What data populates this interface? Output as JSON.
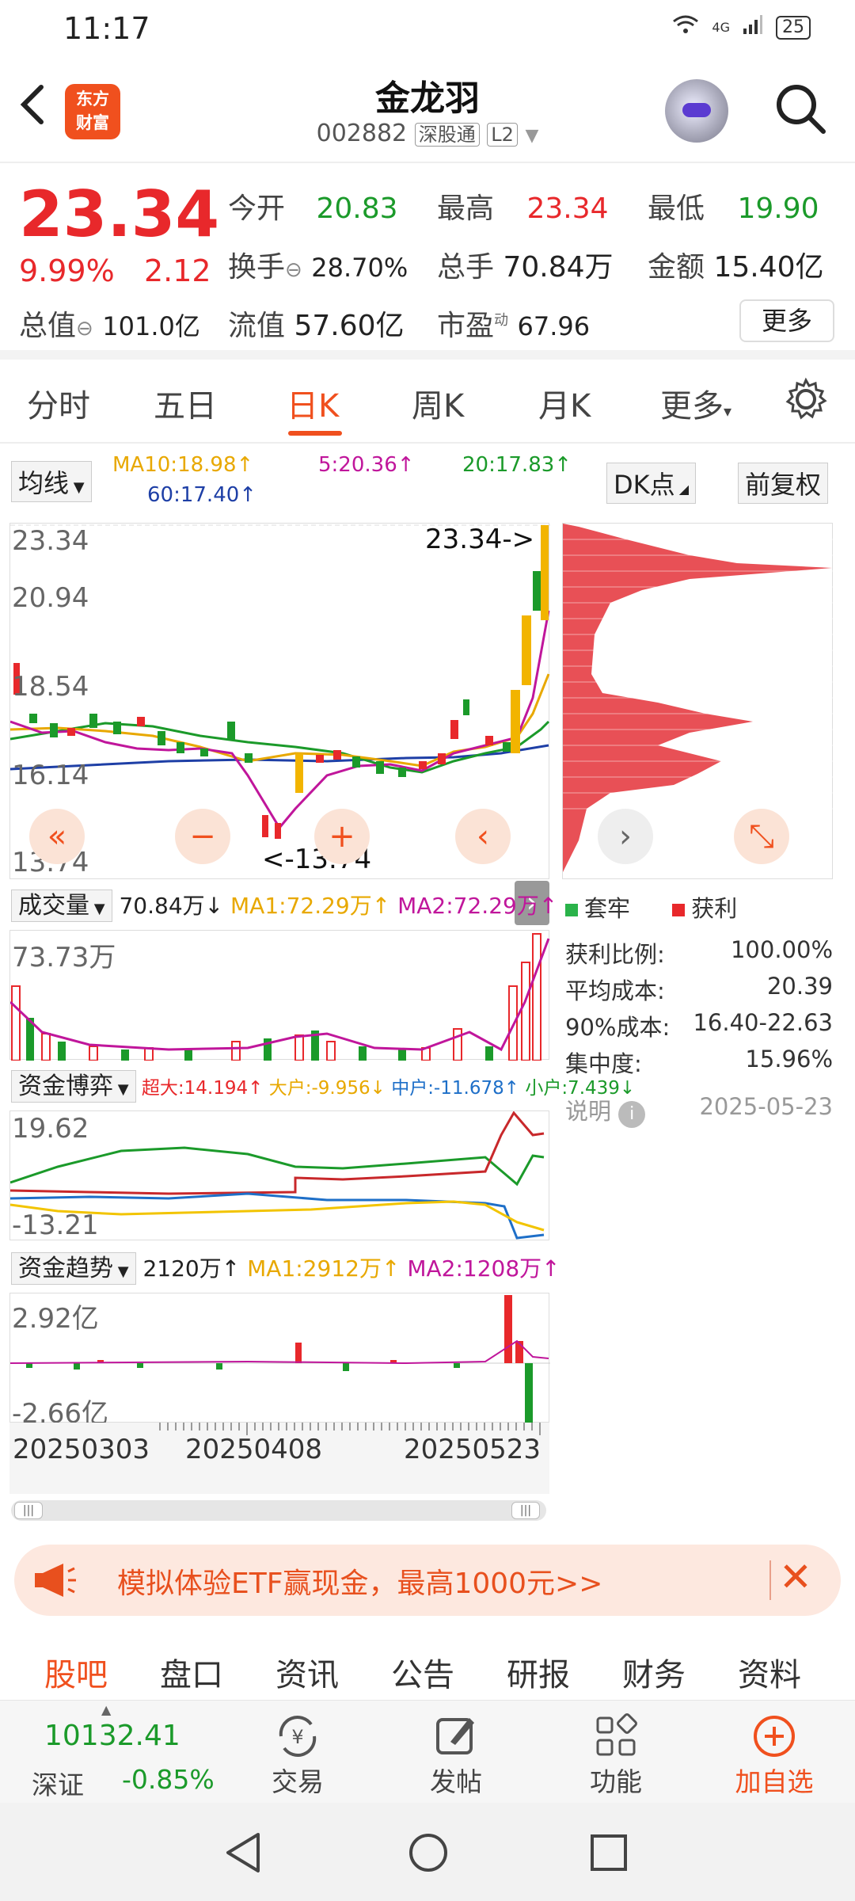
{
  "status": {
    "time": "11:17",
    "network": "4G",
    "battery": "25"
  },
  "header": {
    "brand": [
      "东方",
      "财富"
    ],
    "name": "金龙羽",
    "code": "002882",
    "tag1": "深股通",
    "tag2": "L2"
  },
  "quote": {
    "price": "23.34",
    "pct": "9.99%",
    "change": "2.12",
    "open_label": "今开",
    "open": "20.83",
    "high_label": "最高",
    "high": "23.34",
    "low_label": "最低",
    "low": "19.90",
    "turnover_label": "换手",
    "turnover": "28.70%",
    "volume_label": "总手",
    "volume": "70.84万",
    "amount_label": "金额",
    "amount": "15.40亿",
    "mktcap_label": "总值",
    "mktcap": "101.0亿",
    "float_label": "流值",
    "float": "57.60亿",
    "pe_label": "市盈",
    "pe_sup": "动",
    "pe": "67.96",
    "more": "更多"
  },
  "tabs": [
    "分时",
    "五日",
    "日K",
    "周K",
    "月K",
    "更多"
  ],
  "toolbar": {
    "ma_select": "均线",
    "ma10": "MA10:18.98↑",
    "ma5": "5:20.36↑",
    "ma20": "20:17.83↑",
    "ma60": "60:17.40↑",
    "dk": "DK点",
    "adjust": "前复权"
  },
  "kchart": {
    "y_ticks": [
      "23.34",
      "20.94",
      "18.54",
      "16.14",
      "13.74"
    ],
    "high_marker": "23.34->",
    "low_marker": "<-13.74"
  },
  "volume": {
    "select": "成交量",
    "val": "70.84万↓",
    "ma1": "MA1:72.29万↑",
    "ma2": "MA2:72.29万↑",
    "max": "73.73万"
  },
  "fund_game": {
    "select": "资金博弈",
    "super": "超大:14.194↑",
    "large": "大户:-9.956↓",
    "mid": "中户:-11.678↑",
    "small": "小户:7.439↓",
    "max": "19.62",
    "min": "-13.21"
  },
  "fund_trend": {
    "select": "资金趋势",
    "val": "2120万↑",
    "ma1": "MA1:2912万↑",
    "ma2": "MA2:1208万↑",
    "max": "2.92亿",
    "min": "-2.66亿"
  },
  "dates": [
    "20250303",
    "20250408",
    "20250523"
  ],
  "chip": {
    "legend_trapped": "套牢",
    "legend_profit": "获利",
    "rows": [
      {
        "label": "获利比例:",
        "value": "100.00%"
      },
      {
        "label": "平均成本:",
        "value": "20.39"
      },
      {
        "label": "90%成本:",
        "value": "16.40-22.63"
      },
      {
        "label": "集中度:",
        "value": "15.96%"
      }
    ],
    "note": "说明",
    "date": "2025-05-23"
  },
  "banner": {
    "text": "模拟体验ETF赢现金，最高1000元>>"
  },
  "bottom_tabs": [
    "股吧",
    "盘口",
    "资讯",
    "公告",
    "研报",
    "财务",
    "资料"
  ],
  "dock": {
    "index_value": "10132.41",
    "index_name": "深证",
    "index_pct": "-0.85%",
    "items": [
      "交易",
      "发帖",
      "功能",
      "加自选"
    ]
  },
  "colors": {
    "accent": "#f0501e",
    "up": "#e8282b",
    "down": "#1b9a2a"
  }
}
